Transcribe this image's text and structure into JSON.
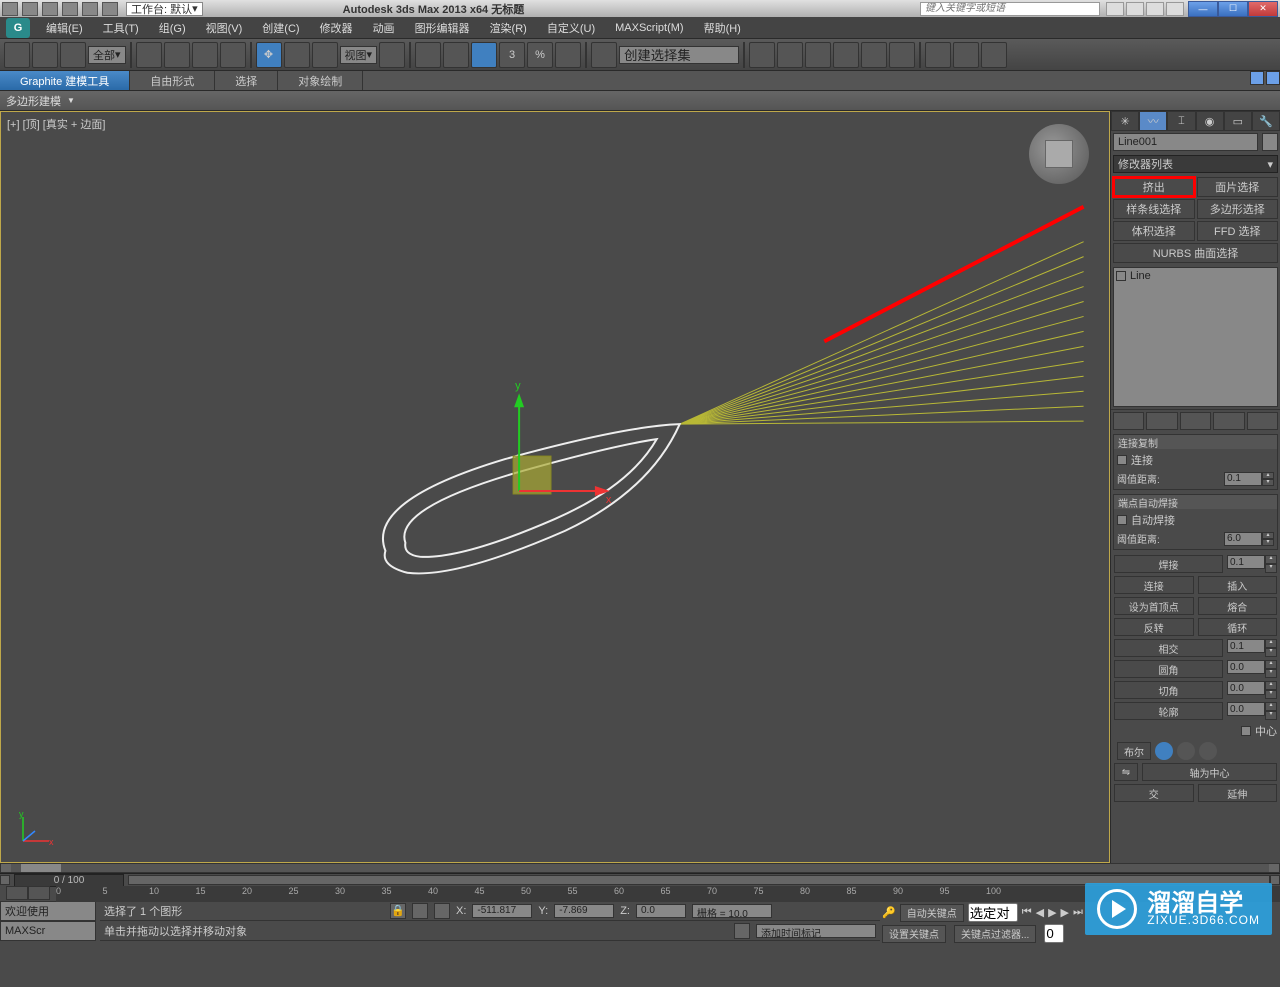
{
  "titlebar": {
    "workspace_label": "工作台: 默认",
    "app_title": "Autodesk 3ds Max  2013 x64   无标题",
    "search_placeholder": "键入关键字或短语"
  },
  "menus": {
    "logo": "G",
    "items": [
      "编辑(E)",
      "工具(T)",
      "组(G)",
      "视图(V)",
      "创建(C)",
      "修改器",
      "动画",
      "图形编辑器",
      "渲染(R)",
      "自定义(U)",
      "MAXScript(M)",
      "帮助(H)"
    ]
  },
  "toolbar": {
    "select_filter": "全部",
    "view_label": "视图",
    "named_sel": "创建选择集"
  },
  "ribbon": {
    "tabs": [
      "Graphite 建模工具",
      "自由形式",
      "选择",
      "对象绘制"
    ],
    "subtab": "多边形建模"
  },
  "viewport": {
    "label": "[+] [顶] [真实 + 边面]",
    "axis_y": "y",
    "axis_x": "x",
    "axis_small_y": "y",
    "axis_small_x": "x"
  },
  "panel": {
    "object_name": "Line001",
    "mod_list_label": "修改器列表",
    "modifiers": [
      {
        "label": "挤出",
        "highlight": true
      },
      {
        "label": "面片选择"
      },
      {
        "label": "样条线选择"
      },
      {
        "label": "多边形选择"
      },
      {
        "label": "体积选择"
      },
      {
        "label": "FFD 选择"
      }
    ],
    "mod_full": "NURBS 曲面选择",
    "stack_item": "Line",
    "rollouts": {
      "connect_copy": {
        "title": "连接复制",
        "checkbox": "连接",
        "threshold_label": "阈值距离:",
        "threshold": "0.1"
      },
      "end_autoweld": {
        "title": "端点自动焊接",
        "checkbox": "自动焊接",
        "threshold_label": "阈值距离:",
        "threshold": "6.0"
      },
      "weld": {
        "btn": "焊接",
        "val": "0.1"
      },
      "connect": {
        "btn": "连接",
        "btn2": "插入"
      },
      "set_first": {
        "btn": "设为首顶点",
        "btn2": "熔合"
      },
      "reverse": {
        "btn": "反转",
        "btn2": "循环"
      },
      "intersect": {
        "btn": "相交",
        "val": "0.1"
      },
      "fillet": {
        "btn": "圆角",
        "val": "0.0"
      },
      "chamfer": {
        "btn": "切角",
        "val": "0.0"
      },
      "outline": {
        "btn": "轮廓",
        "val": "0.0"
      },
      "center_cb": "中心",
      "bool": "布尔",
      "axis_center": "轴为中心",
      "extend": "延伸",
      "cross": "交"
    }
  },
  "timeline": {
    "frame_label": "0 / 100",
    "ticks": [
      "0",
      "5",
      "10",
      "15",
      "20",
      "25",
      "30",
      "35",
      "40",
      "45",
      "50",
      "55",
      "60",
      "65",
      "70",
      "75",
      "80",
      "85",
      "90",
      "95",
      "100"
    ]
  },
  "status": {
    "selected": "选择了 1 个图形",
    "hint": "单击并拖动以选择并移动对象",
    "x_label": "X:",
    "x_val": "-511.817",
    "y_label": "Y:",
    "y_val": "-7.869",
    "z_label": "Z:",
    "z_val": "0.0",
    "grid": "栅格 = 10.0",
    "add_time_tag": "添加时间标记",
    "auto_key": "自动关键点",
    "set_key": "设置关键点",
    "sel_obj": "选定对",
    "key_filter": "关键点过滤器...",
    "welcome": "欢迎使用",
    "maxscr": "MAXScr"
  },
  "watermark": {
    "main": "溜溜自学",
    "sub": "ZIXUE.3D66.COM"
  }
}
